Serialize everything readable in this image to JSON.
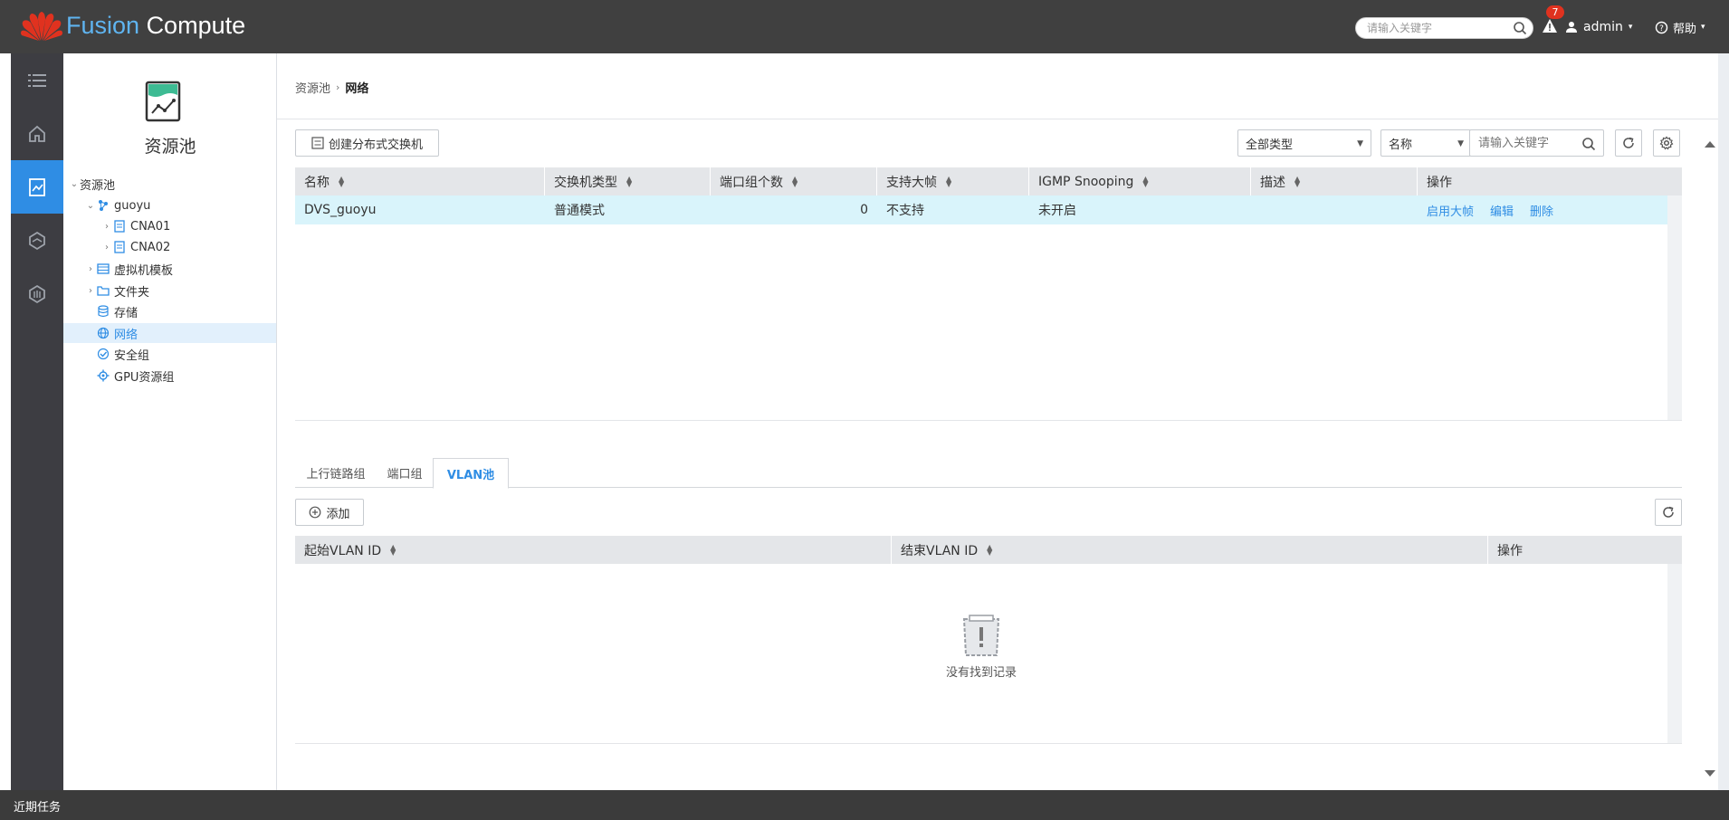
{
  "header": {
    "title_part1": "Fusion",
    "title_part2": "Compute",
    "search_placeholder": "请输入关键字",
    "alarm_count": "7",
    "user": "admin",
    "help": "帮助"
  },
  "rail": {
    "items": [
      "menu-icon",
      "home-icon",
      "resource-pool-icon",
      "network-icon",
      "monitor-icon"
    ],
    "active_index": 2
  },
  "tree": {
    "title": "资源池",
    "nodes": [
      {
        "label": "资源池",
        "icon": "none",
        "expanded": true
      },
      {
        "label": "guoyu",
        "icon": "cluster-icon",
        "expanded": true
      },
      {
        "label": "CNA01",
        "icon": "host-icon",
        "expanded": false
      },
      {
        "label": "CNA02",
        "icon": "host-icon",
        "expanded": false
      },
      {
        "label": "虚拟机模板",
        "icon": "template-icon",
        "expanded": false
      },
      {
        "label": "文件夹",
        "icon": "folder-icon",
        "expanded": false
      },
      {
        "label": "存储",
        "icon": "storage-icon"
      },
      {
        "label": "网络",
        "icon": "network-icon",
        "selected": true
      },
      {
        "label": "安全组",
        "icon": "security-group-icon"
      },
      {
        "label": "GPU资源组",
        "icon": "gpu-icon"
      }
    ]
  },
  "breadcrumb": {
    "parent": "资源池",
    "current": "网络"
  },
  "toolbar": {
    "create_label": "创建分布式交换机",
    "type_filter": "全部类型",
    "field_filter": "名称",
    "search_placeholder": "请输入关键字"
  },
  "switch_table": {
    "columns": [
      "名称",
      "交换机类型",
      "端口组个数",
      "支持大帧",
      "IGMP Snooping",
      "描述",
      "操作"
    ],
    "rows": [
      {
        "name": "DVS_guoyu",
        "type": "普通模式",
        "port_groups": "0",
        "jumbo": "不支持",
        "igmp": "未开启",
        "desc": "",
        "actions": [
          "启用大帧",
          "编辑",
          "删除"
        ]
      }
    ]
  },
  "tabs": {
    "items": [
      "上行链路组",
      "端口组",
      "VLAN池"
    ],
    "active_index": 2
  },
  "vlan_pool": {
    "add_label": "添加",
    "columns": [
      "起始VLAN ID",
      "结束VLAN ID",
      "操作"
    ],
    "empty_text": "没有找到记录"
  },
  "footer": {
    "label": "近期任务"
  },
  "colors": {
    "accent": "#2f8de4",
    "topbar": "#404040",
    "rail": "#3d3d42",
    "row_highlight": "#d9f4fb",
    "alarm": "#e0321f"
  }
}
